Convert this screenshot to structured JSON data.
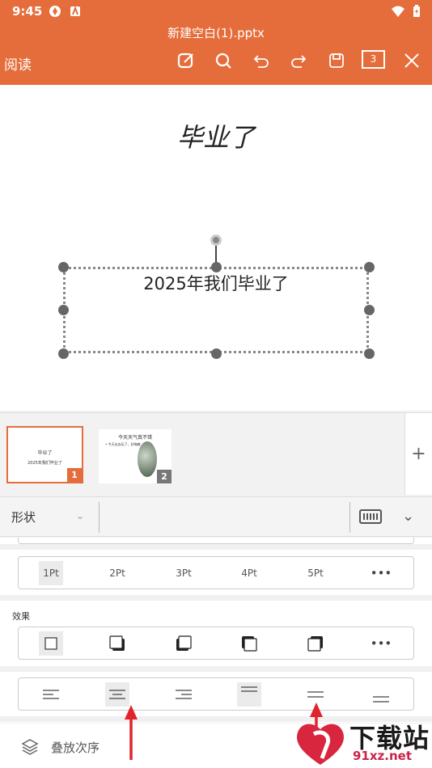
{
  "status_bar": {
    "time": "9:45"
  },
  "header": {
    "filename": "新建空白(1).pptx",
    "read_mode": "阅读",
    "page_count": "3"
  },
  "slide": {
    "title": "毕业了",
    "subtitle": "2025年我们毕业了"
  },
  "thumbnails": [
    {
      "number": "1",
      "title": "毕业了",
      "subtitle": "2025年我们毕业了"
    },
    {
      "number": "2",
      "title": "今天天气真不错",
      "bullet": "• 今天出去玩了，好嗨森"
    }
  ],
  "format_bar": {
    "label": "形状"
  },
  "line_width": {
    "options": [
      "1Pt",
      "2Pt",
      "3Pt",
      "4Pt",
      "5Pt",
      "•••"
    ],
    "selected": "1Pt"
  },
  "effects": {
    "label": "效果",
    "more": "•••"
  },
  "layer_order": {
    "label": "叠放次序"
  },
  "watermark": {
    "text": "下载站",
    "url": "91xz.net"
  },
  "colors": {
    "accent": "#e56d3b",
    "arrow": "#e0252b"
  }
}
